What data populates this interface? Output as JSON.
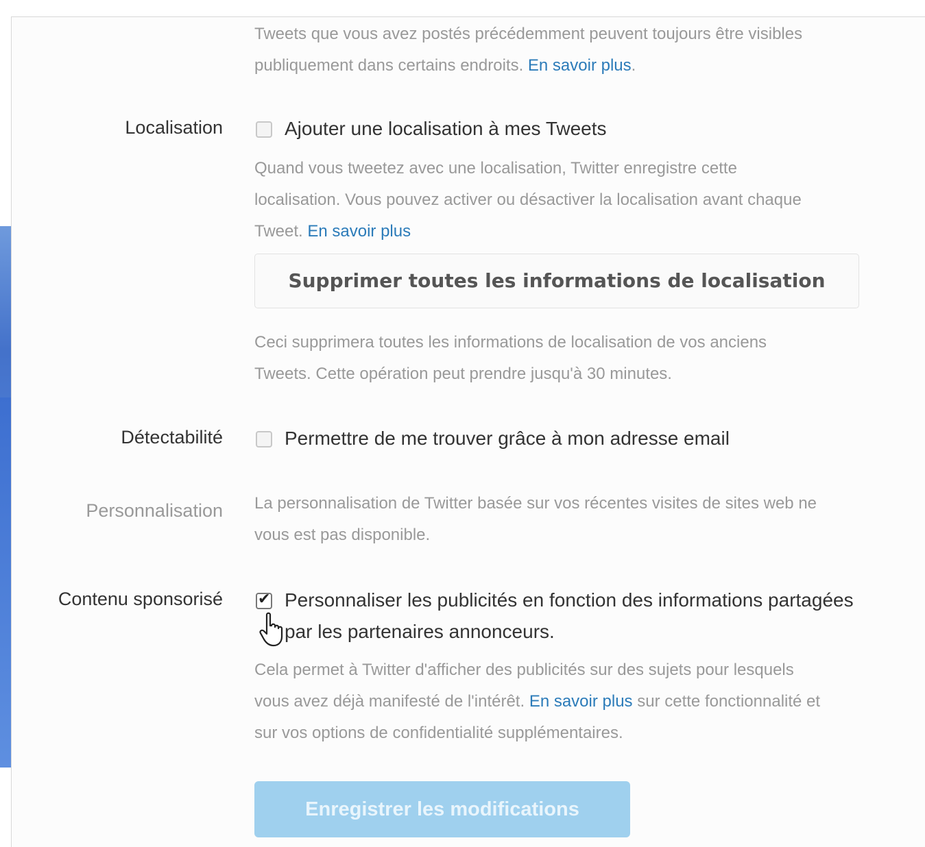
{
  "top_text": {
    "line1": "Tweets que vous avez postés précédemment peuvent toujours être visibles",
    "line2_text": "publiquement dans certains endroits. ",
    "line2_link": "En savoir plus",
    "line2_end": "."
  },
  "location": {
    "label": "Localisation",
    "checkbox_label": "Ajouter une localisation à mes Tweets",
    "checked": false,
    "help_line1": "Quand vous tweetez avec une localisation, Twitter enregistre cette",
    "help_line2": "localisation. Vous pouvez activer ou désactiver la localisation avant chaque",
    "help_line3_text": "Tweet. ",
    "help_line3_link": "En savoir plus",
    "delete_button": "Supprimer toutes les informations de localisation",
    "delete_help_line1": "Ceci supprimera toutes les informations de localisation de vos anciens",
    "delete_help_line2": "Tweets. Cette opération peut prendre jusqu'à 30 minutes."
  },
  "discoverability": {
    "label": "Détectabilité",
    "checkbox_label": "Permettre de me trouver grâce à mon adresse email",
    "checked": false
  },
  "personalization": {
    "label": "Personnalisation",
    "help_line1": "La personnalisation de Twitter basée sur vos récentes visites de sites web ne",
    "help_line2": "vous est pas disponible."
  },
  "sponsored": {
    "label": "Contenu sponsorisé",
    "checkbox_line1": "Personnaliser les publicités en fonction des informations partagées",
    "checkbox_line2": "par les partenaires annonceurs.",
    "checked": true,
    "help_line1": "Cela permet à Twitter d'afficher des publicités sur des sujets pour lesquels",
    "help_line2_text": "vous avez déjà manifesté de l'intérêt. ",
    "help_line2_link": "En savoir plus",
    "help_line2_end": " sur cette fonctionnalité et",
    "help_line3": "sur vos options de confidentialité supplémentaires."
  },
  "save_button": "Enregistrer les modifications",
  "colors": {
    "link": "#2b7bb9",
    "save_button_bg": "#9fd0ee",
    "background_accent": "#3d6fd0"
  }
}
